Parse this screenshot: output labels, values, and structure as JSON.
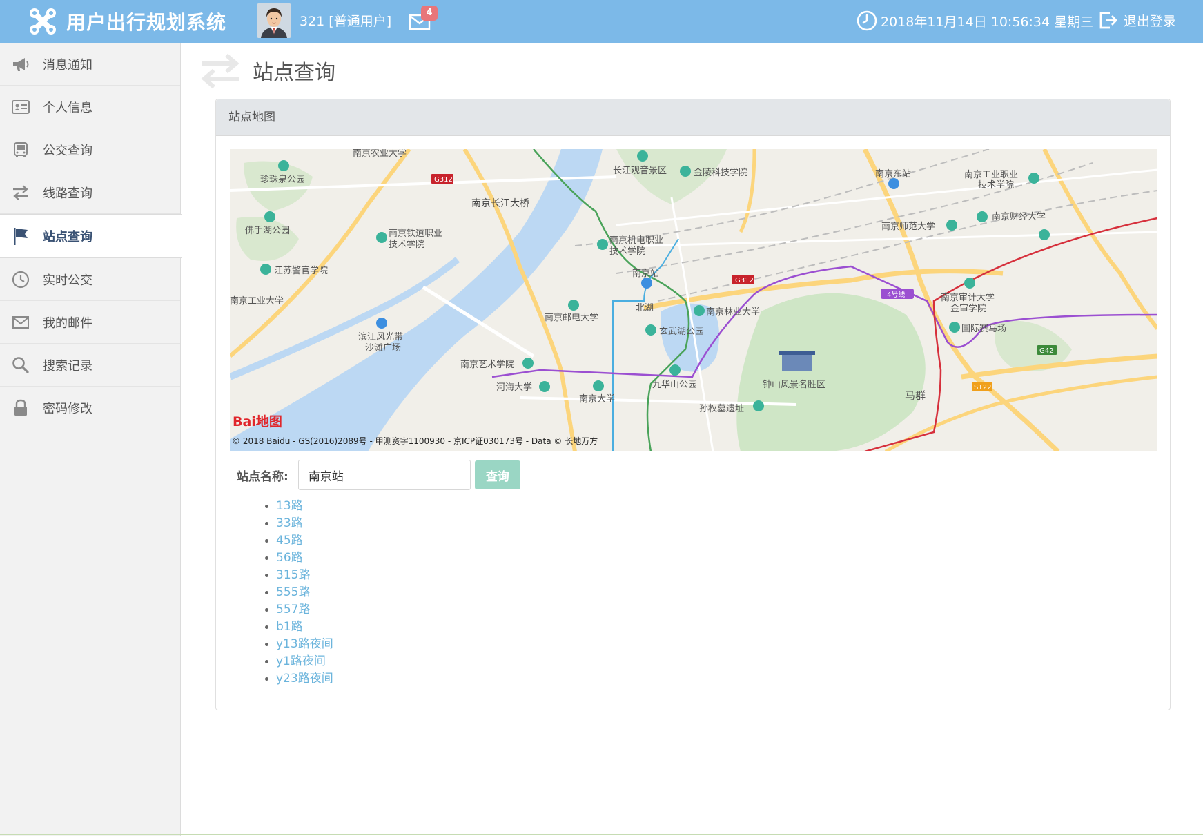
{
  "header": {
    "app_title": "用户出行规划系统",
    "user_info": "321 [普通用户]",
    "mail_count": "4",
    "datetime": "2018年11月14日 10:56:34 星期三",
    "logout_label": "退出登录"
  },
  "sidebar": {
    "items": [
      {
        "label": "消息通知",
        "icon": "megaphone-icon"
      },
      {
        "label": "个人信息",
        "icon": "id-card-icon"
      },
      {
        "label": "公交查询",
        "icon": "bus-icon"
      },
      {
        "label": "线路查询",
        "icon": "exchange-icon"
      },
      {
        "label": "站点查询",
        "icon": "flag-icon",
        "active": true
      },
      {
        "label": "实时公交",
        "icon": "clock-icon"
      },
      {
        "label": "我的邮件",
        "icon": "envelope-icon"
      },
      {
        "label": "搜索记录",
        "icon": "search-icon"
      },
      {
        "label": "密码修改",
        "icon": "lock-icon"
      }
    ]
  },
  "page": {
    "title": "站点查询"
  },
  "panel": {
    "heading": "站点地图"
  },
  "map": {
    "copyright": "© 2018 Baidu - GS(2016)2089号 - 甲测资字1100930 - 京ICP证030173号 - Data © 长地万方",
    "logo_text": "Bai地图",
    "labels": {
      "l1": "南京农业大学",
      "l2": "长江观音景区",
      "l3": "金陵科技学院",
      "l4": "南京东站",
      "l5": "南京工业职业",
      "l5b": "技术学院",
      "l6": "珍珠泉公园",
      "l7": "南京长江大桥",
      "l8": "南京财经大学",
      "l9": "南京师范大学",
      "l10": "佛手湖公园",
      "l11": "南京铁道职业",
      "l11b": "技术学院",
      "l12": "南京机电职业",
      "l12b": "技术学院",
      "l13": "江苏警官学院",
      "l14": "南京站",
      "l15": "南京审计大学",
      "l15b": "金审学院",
      "l16": "南京工业大学",
      "l17": "北湖",
      "l18": "南京林业大学",
      "l19": "南京邮电大学",
      "l20": "国际赛马场",
      "l21": "滨江风光带",
      "l21b": "沙滩广场",
      "l22": "玄武湖公园",
      "l23": "南京艺术学院",
      "l24": "钟山风景名胜区",
      "l25": "九华山公园",
      "l26": "河海大学",
      "l27": "南京大学",
      "l28": "马群",
      "l29": "孙权墓遗址",
      "shield_g312a": "G312",
      "shield_g312b": "G312",
      "shield_g42": "G42",
      "shield_s122": "S122",
      "metro_line4": "4号线"
    }
  },
  "search": {
    "label": "站点名称:",
    "value": "南京站",
    "button": "查询"
  },
  "routes": [
    "13路",
    "33路",
    "45路",
    "56路",
    "315路",
    "555路",
    "557路",
    "b1路",
    "y13路夜间",
    "y1路夜间",
    "y23路夜间"
  ],
  "colors": {
    "header_bg": "#7cb9e8",
    "sidebar_bg": "#f2f2f2",
    "link": "#6bb4dc",
    "button": "#9ad6c4",
    "badge": "#e8767a",
    "active_item_text": "#3a5274"
  }
}
